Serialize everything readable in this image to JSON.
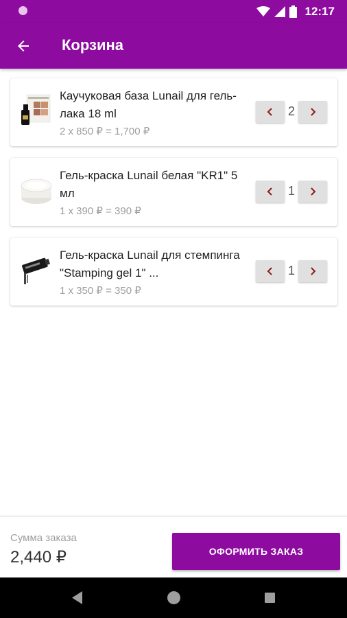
{
  "status_bar": {
    "time": "12:17",
    "icons": [
      "wifi-icon",
      "signal-icon",
      "battery-icon"
    ]
  },
  "app_bar": {
    "title": "Корзина",
    "back_icon": "arrow-back-icon"
  },
  "cart": {
    "items": [
      {
        "name": "Каучуковая база Lunail для гель-лака 18 ml",
        "price_line": "2 x 850 ₽ = 1,700 ₽",
        "quantity": "2",
        "image": "base-coat-product-image"
      },
      {
        "name": "Гель-краска Lunail белая \"KR1\" 5 мл",
        "price_line": "1 x 390 ₽ = 390 ₽",
        "quantity": "1",
        "image": "gel-paint-jar-image"
      },
      {
        "name": "Гель-краска Lunail для стемпинга \"Stamping gel 1\" ...",
        "price_line": "1 x 350 ₽ = 350 ₽",
        "quantity": "1",
        "image": "stamping-gel-tube-image"
      }
    ],
    "minus_icon": "chevron-left-icon",
    "plus_icon": "chevron-right-icon"
  },
  "footer": {
    "sum_label": "Сумма заказа",
    "sum_value": "2,440 ₽",
    "checkout_label": "ОФОРМИТЬ ЗАКАЗ"
  },
  "colors": {
    "primary": "#8e0ba0",
    "stepper_arrow": "#8b1a1a",
    "stepper_bg": "#e0e0e0"
  }
}
